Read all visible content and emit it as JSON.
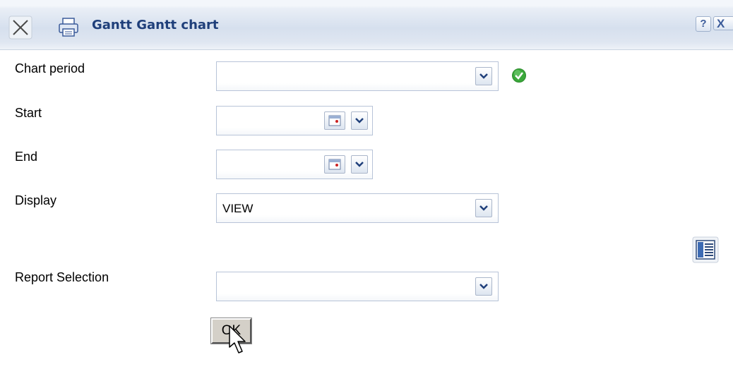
{
  "window": {
    "title": "Gantt Gantt chart",
    "help_label": "?",
    "close_label": "X",
    "icons": {
      "close": "close-x-icon",
      "print": "printer-icon"
    }
  },
  "form": {
    "chart_period": {
      "label": "Chart period",
      "value": "",
      "status_icon": "green-check-icon"
    },
    "start": {
      "label": "Start",
      "value": ""
    },
    "end": {
      "label": "End",
      "value": ""
    },
    "display": {
      "label": "Display",
      "value": "VIEW"
    },
    "report_selection": {
      "label": "Report Selection",
      "value": ""
    },
    "ok_label": "OK",
    "side_icon": "report-layout-icon"
  },
  "colors": {
    "title_text": "#1f3f7a",
    "titlebar_bg": "#d6e0ee",
    "field_border": "#b8c4d8",
    "status_ok": "#3aa83a"
  }
}
